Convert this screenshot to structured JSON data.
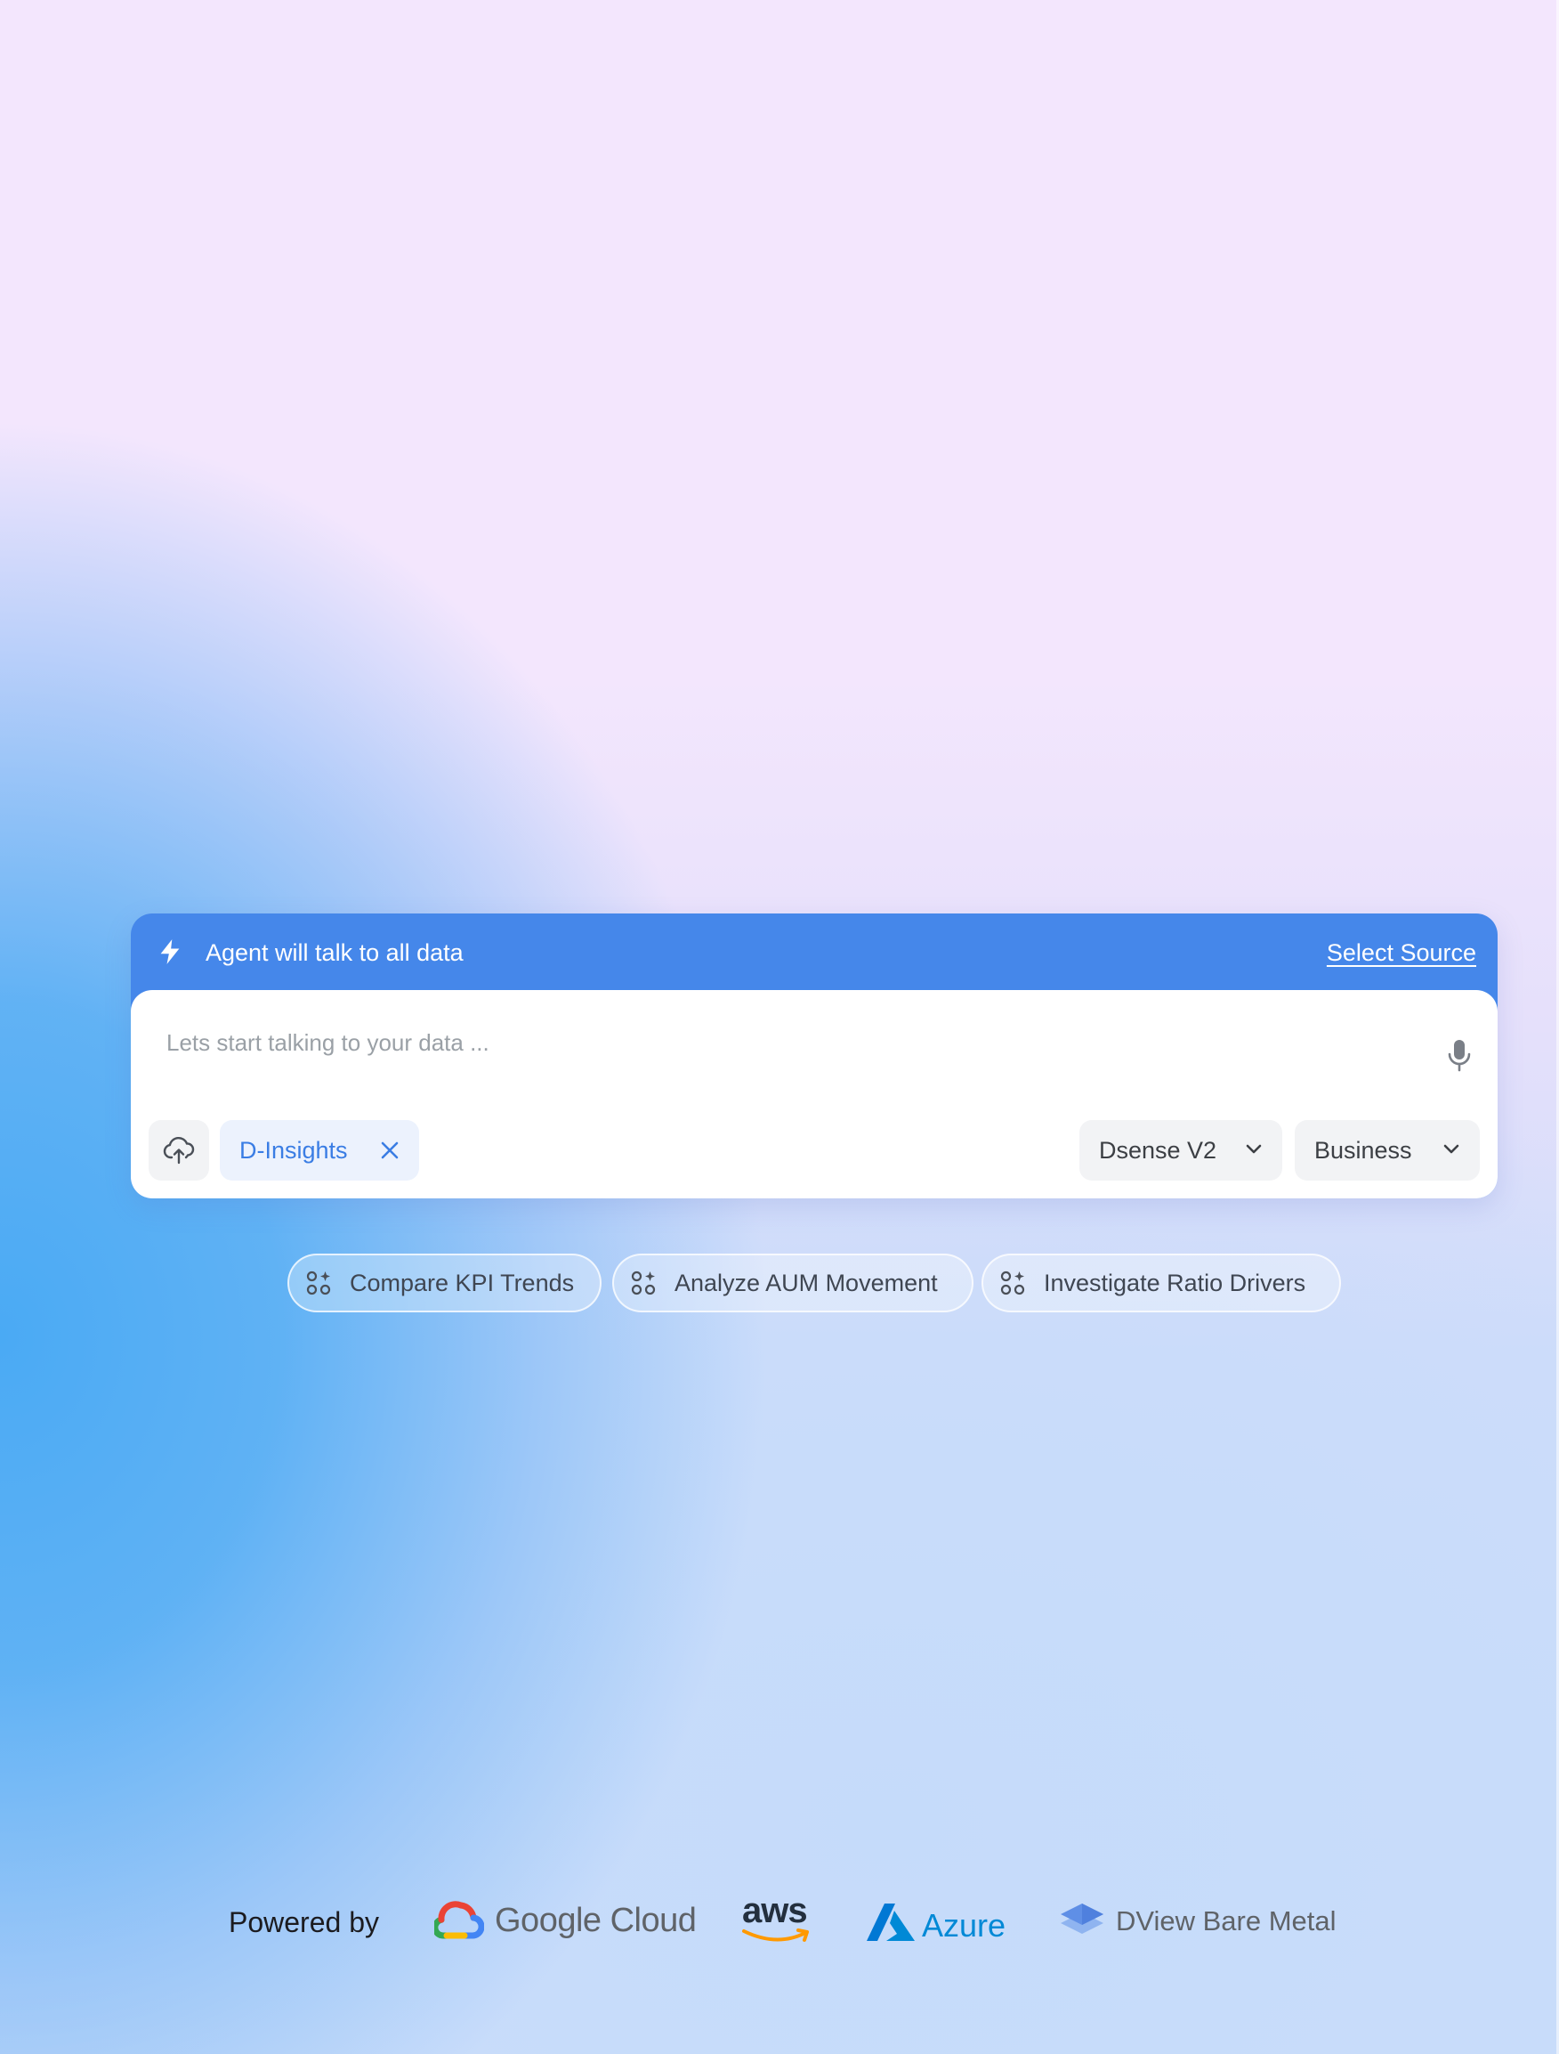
{
  "banner": {
    "text": "Agent will talk to all data",
    "select_source_label": "Select Source"
  },
  "prompt": {
    "placeholder": "Lets start talking to your data ...",
    "value": ""
  },
  "toolbar": {
    "source_chip_label": "D-Insights",
    "model_dropdown_value": "Dsense V2",
    "mode_dropdown_value": "Business"
  },
  "suggestions": [
    {
      "label": "Compare KPI Trends"
    },
    {
      "label": "Analyze AUM Movement"
    },
    {
      "label": "Investigate Ratio Drivers"
    }
  ],
  "footer": {
    "powered_by_label": "Powered by",
    "providers": [
      {
        "name": "Google Cloud"
      },
      {
        "name": "aws"
      },
      {
        "name": "Azure"
      },
      {
        "name": "DView Bare Metal"
      }
    ]
  },
  "colors": {
    "banner_blue": "#4587ea",
    "chip_text_blue": "#3a7de4",
    "chip_bg": "#ecf2fd",
    "control_bg": "#f2f3f5"
  },
  "icons": {
    "banner": "lightning-bolt-icon",
    "mic": "microphone-icon",
    "upload": "cloud-upload-icon",
    "remove": "close-icon",
    "dropdown": "chevron-down-icon",
    "suggestion": "sparkle-grid-icon"
  }
}
